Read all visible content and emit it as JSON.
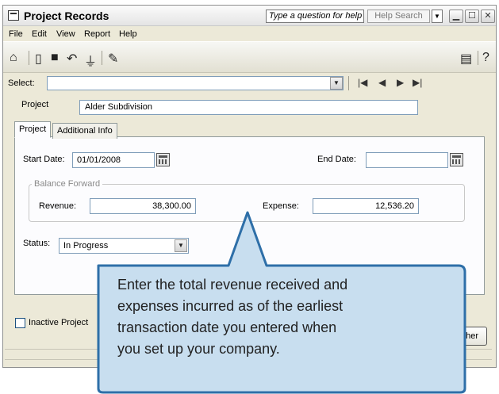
{
  "window": {
    "title": "Project Records",
    "help_placeholder": "Type a question for help",
    "help_search_label": "Help Search"
  },
  "menu": [
    "File",
    "Edit",
    "View",
    "Report",
    "Help"
  ],
  "toolbar": {
    "icons": [
      "home-icon",
      "new-record-icon",
      "save-icon",
      "undo-icon",
      "filter-icon",
      "pen-icon",
      "notepad-icon",
      "help-icon"
    ],
    "help_glyph": "?"
  },
  "select": {
    "label": "Select:",
    "value": ""
  },
  "project": {
    "label": "Project",
    "value": "Alder Subdivision"
  },
  "tabs": [
    {
      "label": "Project",
      "active": true
    },
    {
      "label": "Additional Info",
      "active": false
    }
  ],
  "dates": {
    "start_label": "Start Date:",
    "start_value": "01/01/2008",
    "end_label": "End Date:",
    "end_value": ""
  },
  "balance": {
    "group_label": "Balance Forward",
    "revenue_label": "Revenue:",
    "revenue_value": "38,300.00",
    "expense_label": "Expense:",
    "expense_value": "12,536.20"
  },
  "status": {
    "label": "Status:",
    "value": "In Progress"
  },
  "inactive": {
    "label": "Inactive Project",
    "checked": false
  },
  "other_button_label": "her",
  "callout": {
    "lines": [
      "Enter the total revenue received and",
      "expenses incurred as of the earliest",
      "transaction date you entered when",
      "you set up your company."
    ],
    "fill": "#c8deef",
    "border": "#2e6fa8"
  }
}
